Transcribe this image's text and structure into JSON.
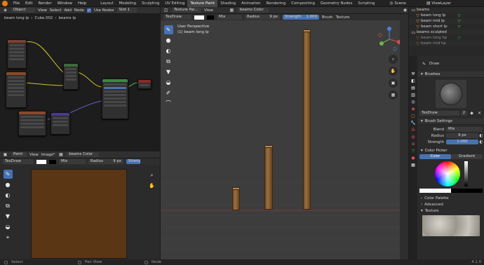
{
  "menu": [
    "File",
    "Edit",
    "Render",
    "Window",
    "Help"
  ],
  "workspaces": [
    "Layout",
    "Modeling",
    "Sculpting",
    "UV Editing",
    "Texture Paint",
    "Shading",
    "Animation",
    "Rendering",
    "Compositing",
    "Geometry Nodes",
    "Scripting"
  ],
  "active_workspace": "Texture Paint",
  "scene": "Scene",
  "view_layer": "ViewLayer",
  "node_editor": {
    "mode": "Object",
    "menus": [
      "View",
      "Select",
      "Add",
      "Node"
    ],
    "use_nodes_label": "Use Nodes",
    "slot": "Slot 1",
    "breadcrumb": [
      "beam long lp",
      "Cube.002",
      "beams lp"
    ]
  },
  "image_editor": {
    "mode": "Paint",
    "menus": [
      "View",
      "Image*"
    ],
    "image_name": "beams Color",
    "brush": "TexDraw",
    "blend": "Mix",
    "radius_label": "Radius",
    "radius_value": "9 px",
    "strength_label": "Strengt"
  },
  "viewport": {
    "mode": "Texture Pai...",
    "menu": "View",
    "brush": "TexDraw",
    "blend": "Mix",
    "image_name": "beams Color",
    "radius_label": "Radius",
    "radius_value": "9 px",
    "strength_label": "Strength",
    "strength_value": "1.000",
    "brush_menu": "Brush",
    "texture_menu": "Texture",
    "perspective": "User Perspective",
    "object_label": "(1) beam long lp"
  },
  "outliner": {
    "rows": [
      {
        "name": "beams",
        "icon": "collection-icon"
      },
      {
        "name": "beam long lp",
        "icon": "mesh-icon"
      },
      {
        "name": "beam mid lp",
        "icon": "mesh-icon"
      },
      {
        "name": "beam short lp",
        "icon": "mesh-icon"
      },
      {
        "name": "beams sculpted",
        "icon": "collection-icon"
      },
      {
        "name": "beam long hp",
        "icon": "mesh-icon"
      },
      {
        "name": "beam mid hp",
        "icon": "mesh-icon"
      }
    ]
  },
  "properties": {
    "tool_name": "Draw",
    "brushes_label": "Brushes",
    "brush_name": "TexDraw",
    "brush_users": "2",
    "brush_settings_label": "Brush Settings",
    "blend_label": "Blend",
    "blend_value": "Mix",
    "radius_label": "Radius",
    "radius_value": "9 px",
    "strength_label": "Strength",
    "strength_value": "1.000",
    "color_picker_label": "Color Picker",
    "color_tab": "Color",
    "gradient_tab": "Gradient",
    "color_palette_label": "Color Palette",
    "advanced_label": "Advanced",
    "texture_label": "Texture"
  },
  "status": {
    "left": "Select",
    "middle": "Pan View",
    "right": "Node",
    "version": "4.1.0"
  },
  "colors": {
    "accent": "#4772b3",
    "paint_color": "#5a3615",
    "beam_wood": "#9c7040"
  }
}
